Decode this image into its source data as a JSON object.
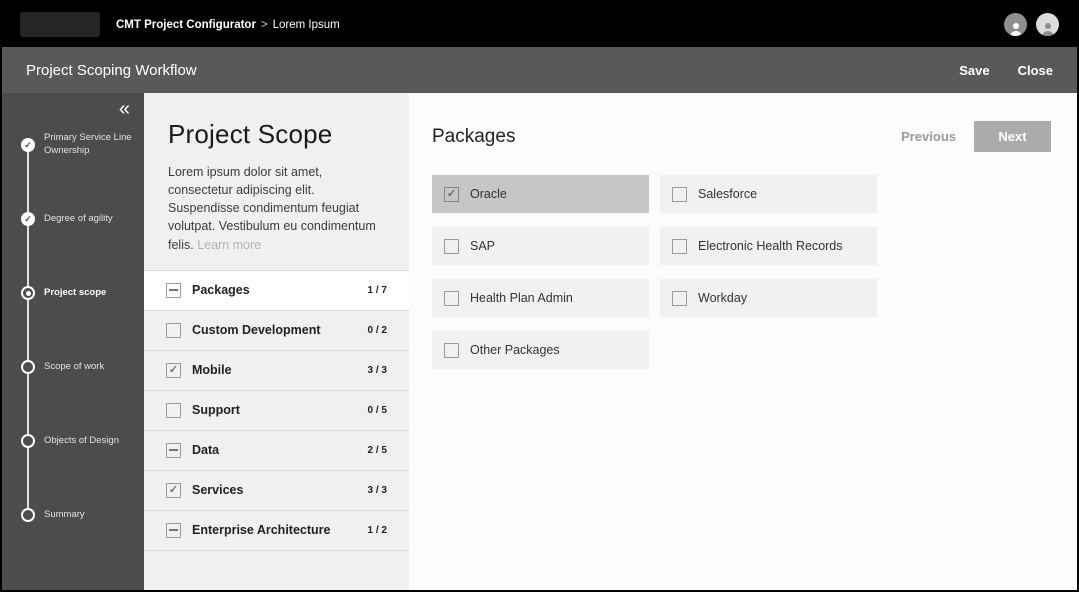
{
  "topbar": {
    "breadcrumb": {
      "app": "CMT Project Configurator",
      "separator": ">",
      "page": "Lorem Ipsum"
    }
  },
  "workflow_bar": {
    "title": "Project Scoping Workflow",
    "save_label": "Save",
    "close_label": "Close"
  },
  "stepper": {
    "steps": [
      {
        "label": "Primary Service Line Ownership",
        "state": "complete"
      },
      {
        "label": "Degree of agility",
        "state": "complete"
      },
      {
        "label": "Project scope",
        "state": "current"
      },
      {
        "label": "Scope of work",
        "state": "upcoming"
      },
      {
        "label": "Objects of Design",
        "state": "upcoming"
      },
      {
        "label": "Summary",
        "state": "upcoming"
      }
    ]
  },
  "scope_panel": {
    "title": "Project Scope",
    "description": "Lorem ipsum dolor sit amet, consectetur adipiscing elit. Suspendisse condimentum feugiat volutpat. Vestibulum eu condimentum felis.",
    "learn_more_label": "Learn more",
    "categories": [
      {
        "label": "Packages",
        "count": "1 / 7",
        "state": "indeterminate",
        "selected": true
      },
      {
        "label": "Custom Development",
        "count": "0 / 2",
        "state": "unchecked",
        "selected": false
      },
      {
        "label": "Mobile",
        "count": "3 / 3",
        "state": "checked",
        "selected": false
      },
      {
        "label": "Support",
        "count": "0 / 5",
        "state": "unchecked",
        "selected": false
      },
      {
        "label": "Data",
        "count": "2 / 5",
        "state": "indeterminate",
        "selected": false
      },
      {
        "label": "Services",
        "count": "3 / 3",
        "state": "checked",
        "selected": false
      },
      {
        "label": "Enterprise Architecture",
        "count": "1 / 2",
        "state": "indeterminate",
        "selected": false
      }
    ]
  },
  "main": {
    "title": "Packages",
    "previous_label": "Previous",
    "next_label": "Next",
    "options": [
      {
        "label": "Oracle",
        "checked": true,
        "selected": true
      },
      {
        "label": "Salesforce",
        "checked": false,
        "selected": false
      },
      {
        "label": "SAP",
        "checked": false,
        "selected": false
      },
      {
        "label": "Electronic Health Records",
        "checked": false,
        "selected": false
      },
      {
        "label": "Health Plan Admin",
        "checked": false,
        "selected": false
      },
      {
        "label": "Workday",
        "checked": false,
        "selected": false
      },
      {
        "label": "Other Packages",
        "checked": false,
        "selected": false
      }
    ]
  },
  "icons": {
    "collapse": "«",
    "check": "✓"
  },
  "colors": {
    "topbar_bg": "#000000",
    "toolbar_bg": "#595959",
    "sidebar_bg": "#4c4c4c",
    "panel_bg": "#f0f0f0",
    "card_bg": "#f1f1f1",
    "selected_card_bg": "#c6c6c6",
    "next_button_bg": "#ababab"
  }
}
